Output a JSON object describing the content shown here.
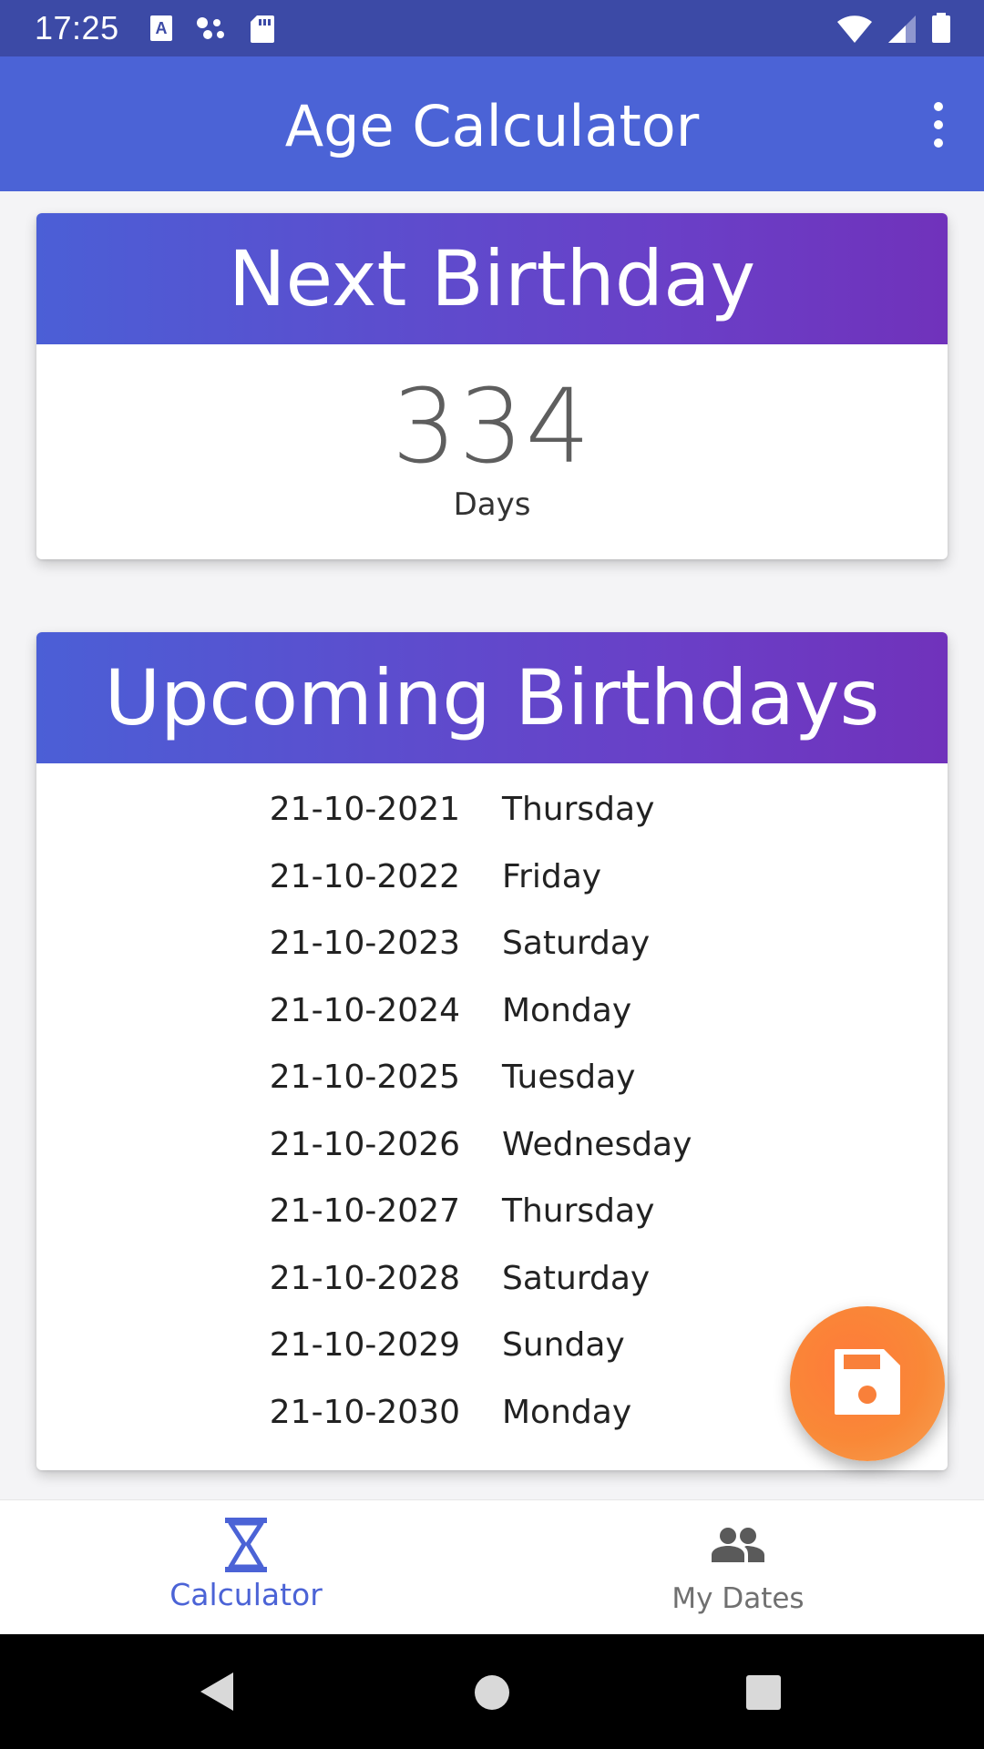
{
  "status_bar": {
    "time": "17:25"
  },
  "app_bar": {
    "title": "Age Calculator"
  },
  "next_birthday": {
    "title": "Next Birthday",
    "value": "334",
    "unit": "Days"
  },
  "upcoming": {
    "title": "Upcoming Birthdays",
    "rows": [
      {
        "date": "21-10-2021",
        "day": "Thursday"
      },
      {
        "date": "21-10-2022",
        "day": "Friday"
      },
      {
        "date": "21-10-2023",
        "day": "Saturday"
      },
      {
        "date": "21-10-2024",
        "day": "Monday"
      },
      {
        "date": "21-10-2025",
        "day": "Tuesday"
      },
      {
        "date": "21-10-2026",
        "day": "Wednesday"
      },
      {
        "date": "21-10-2027",
        "day": "Thursday"
      },
      {
        "date": "21-10-2028",
        "day": "Saturday"
      },
      {
        "date": "21-10-2029",
        "day": "Sunday"
      },
      {
        "date": "21-10-2030",
        "day": "Monday"
      }
    ]
  },
  "fab": {
    "icon": "save-icon",
    "color": "#f9803a"
  },
  "bottom_nav": {
    "items": [
      {
        "label": "Calculator",
        "icon": "hourglass-icon",
        "active": true
      },
      {
        "label": "My Dates",
        "icon": "people-icon",
        "active": false
      }
    ]
  },
  "colors": {
    "status_bar": "#3c4aa6",
    "app_bar": "#4b63d6",
    "header_gradient_start": "#4b5fd6",
    "header_gradient_end": "#7032bb",
    "accent": "#4b63d6"
  }
}
